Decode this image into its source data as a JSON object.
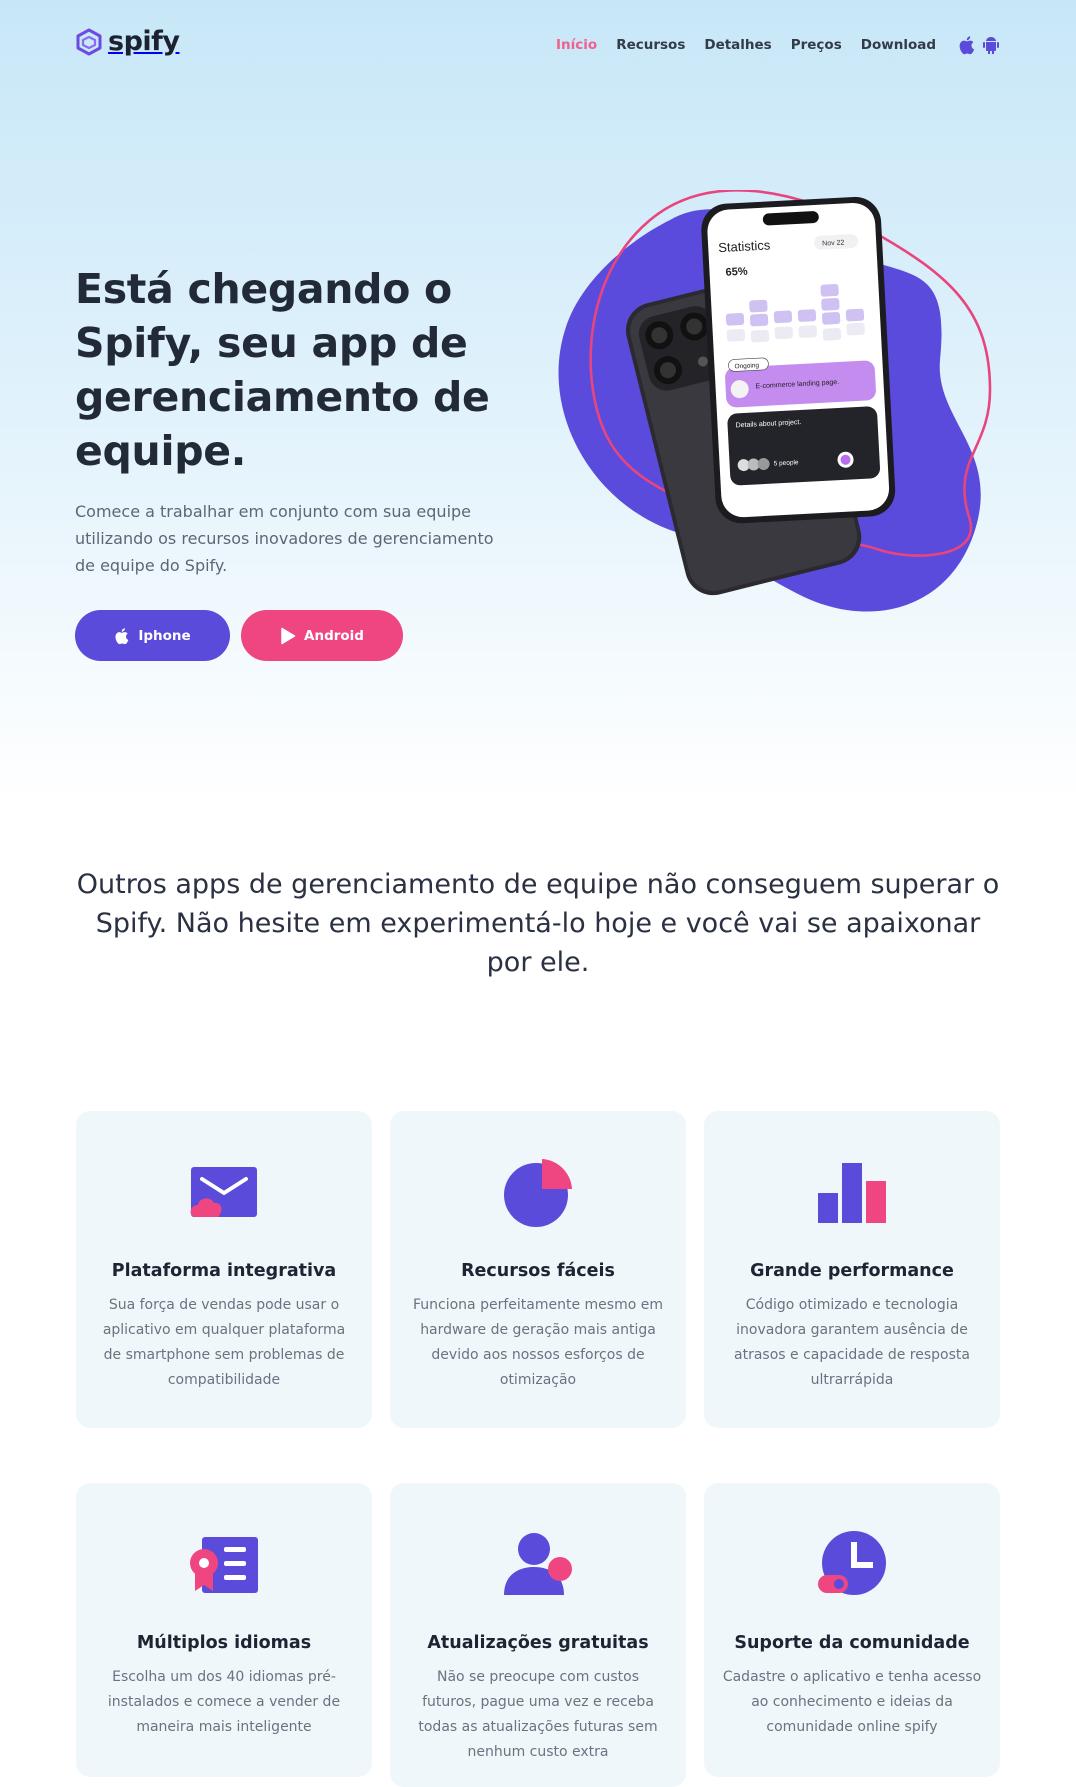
{
  "brand": {
    "name": "spify",
    "color": "#5b4bdb",
    "accent": "#ef4681"
  },
  "nav": {
    "items": [
      {
        "label": "Início",
        "active": true
      },
      {
        "label": "Recursos",
        "active": false
      },
      {
        "label": "Detalhes",
        "active": false
      },
      {
        "label": "Preços",
        "active": false
      },
      {
        "label": "Download",
        "active": false
      }
    ],
    "store_icons": [
      "apple-icon",
      "android-icon"
    ]
  },
  "hero": {
    "title": "Está chegando o Spify, seu app de gerenciamento de equipe.",
    "subtitle": "Comece a trabalhar em conjunto com sua equipe utilizando os recursos inovadores de gerenciamento de equipe do Spify.",
    "buttons": {
      "iphone": {
        "label": "Iphone",
        "icon": "apple-icon"
      },
      "android": {
        "label": "Android",
        "icon": "play-icon"
      }
    },
    "phone": {
      "title": "Statistics",
      "percent": "65%",
      "date": "Nov 22",
      "status": "Ongoing",
      "task": "E-commerce landing page.",
      "details": "Details about project.",
      "people": "5 people"
    }
  },
  "tagline": "Outros apps de gerenciamento de equipe não conseguem superar o Spify. Não hesite em experimentá-lo hoje e você vai se apaixonar por ele.",
  "features": [
    {
      "icon": "envelope-cloud-icon",
      "title": "Plataforma integrativa",
      "text": "Sua força de vendas pode usar o aplicativo em qualquer plataforma de smartphone sem problemas de compatibilidade"
    },
    {
      "icon": "pie-chart-icon",
      "title": "Recursos fáceis",
      "text": "Funciona perfeitamente mesmo em hardware de geração mais antiga devido aos nossos esforços de otimização"
    },
    {
      "icon": "bar-chart-icon",
      "title": "Grande performance",
      "text": "Código otimizado e tecnologia inovadora garantem ausência de atrasos e capacidade de resposta ultrarrápida"
    },
    {
      "icon": "language-list-icon",
      "title": "Múltiplos idiomas",
      "text": "Escolha um dos 40 idiomas pré-instalados e comece a vender de maneira mais inteligente"
    },
    {
      "icon": "user-update-icon",
      "title": "Atualizações gratuitas",
      "text": "Não se preocupe com custos futuros, pague uma vez e receba todas as atualizações futuras sem nenhum custo extra"
    },
    {
      "icon": "clock-support-icon",
      "title": "Suporte da comunidade",
      "text": "Cadastre o aplicativo e tenha acesso ao conhecimento e ideias da comunidade online spify"
    }
  ]
}
